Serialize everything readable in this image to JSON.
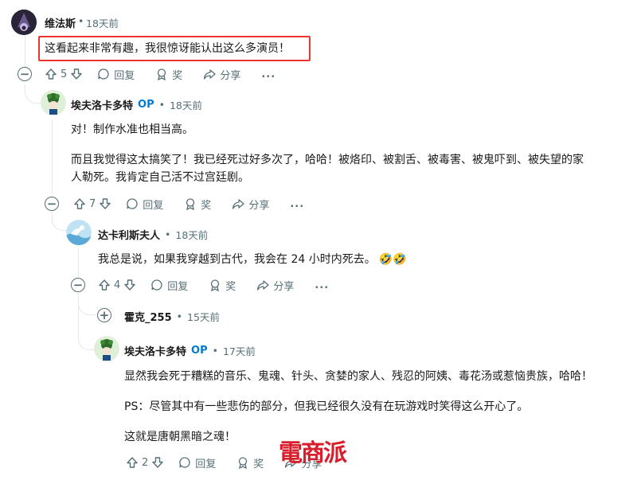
{
  "comments": {
    "c1": {
      "username": "维法斯",
      "time": "18天前",
      "text": "这看起来非常有趣，我很惊讶能认出这么多演员！",
      "votes": "5",
      "reply_label": "回复",
      "award_label": "奖",
      "share_label": "分享",
      "more_label": "..."
    },
    "c2": {
      "username": "埃夫洛卡多特",
      "op_label": "OP",
      "time": "18天前",
      "text1": "对！制作水准也相当高。",
      "text2a": "而且我觉得这太搞笑了！我已经死过好多次了，哈哈！被烙印、被割舌、被毒害、被鬼吓到、被失望的家",
      "text2b": "人勒死。我肯定自己活不过宫廷剧。",
      "votes": "7",
      "reply_label": "回复",
      "award_label": "奖",
      "share_label": "分享",
      "more_label": "..."
    },
    "c3": {
      "username": "达卡利斯夫人",
      "time": "18天前",
      "text": "我总是说，如果我穿越到古代，我会在 24 小时内死去。",
      "emoji": "🤣🤣",
      "votes": "4",
      "reply_label": "回复",
      "award_label": "奖",
      "share_label": "分享",
      "more_label": "..."
    },
    "c4": {
      "username": "霍克_255",
      "time": "15天前"
    },
    "c5": {
      "username": "埃夫洛卡多特",
      "op_label": "OP",
      "time": "17天前",
      "text1": "显然我会死于糟糕的音乐、鬼魂、针头、贪婪的家人、残忍的阿姨、毒花汤或惹恼贵族，哈哈！",
      "text2": "PS：尽管其中有一些悲伤的部分，但我已经很久没有在玩游戏时笑得这么开心了。",
      "text3": "这就是唐朝黑暗之魂！",
      "votes": "2",
      "reply_label": "回复",
      "award_label": "奖",
      "share_label": "分享"
    }
  },
  "watermark": "電商派",
  "colors": {
    "highlight": "#e8362e",
    "op": "#0079d3",
    "meta": "#576f76",
    "thread_line": "#e5e7e9"
  }
}
